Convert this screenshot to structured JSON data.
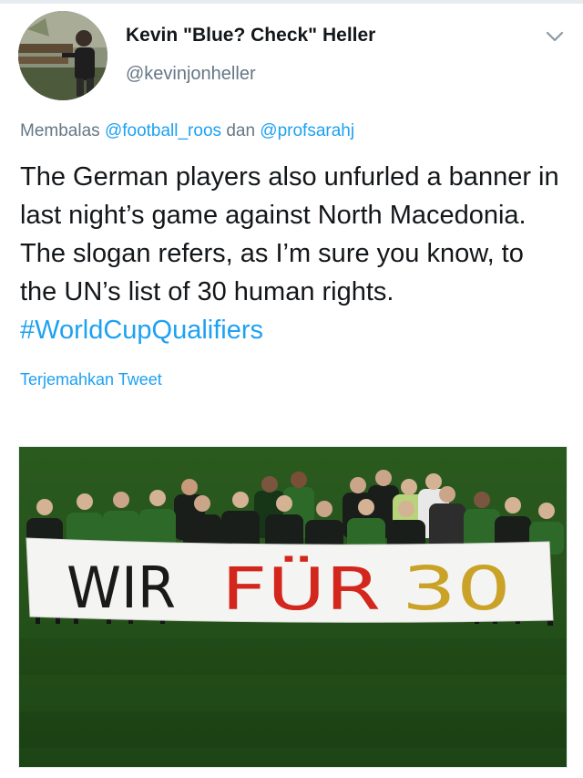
{
  "tweet": {
    "author": {
      "display_name": "Kevin \"Blue? Check\" Heller",
      "handle": "@kevinjonheller",
      "avatar_icon": "profile-photo"
    },
    "menu_icon": "chevron-down-icon",
    "reply": {
      "prefix": "Membalas",
      "mention_1": "@football_roos",
      "conjunction": "dan",
      "mention_2": "@profsarahj"
    },
    "text": "The German players also unfurled a banner in last night’s game against North Macedonia. The slogan refers, as I’m sure you know, to the UN’s list of 30 human rights.",
    "hashtag": "#WorldCupQualifiers",
    "translate_label": "Terjemahkan Tweet",
    "media": {
      "banner": {
        "word_1": "WIR",
        "word_2": "FÜR",
        "word_3": "30"
      }
    },
    "colors": {
      "link": "#1da1f2",
      "secondary_text": "#657786",
      "primary_text": "#14171a",
      "pitch_green": "#1f4a18",
      "banner_black": "#1a1a1a",
      "banner_red": "#d3261c",
      "banner_gold": "#c9a227"
    }
  }
}
